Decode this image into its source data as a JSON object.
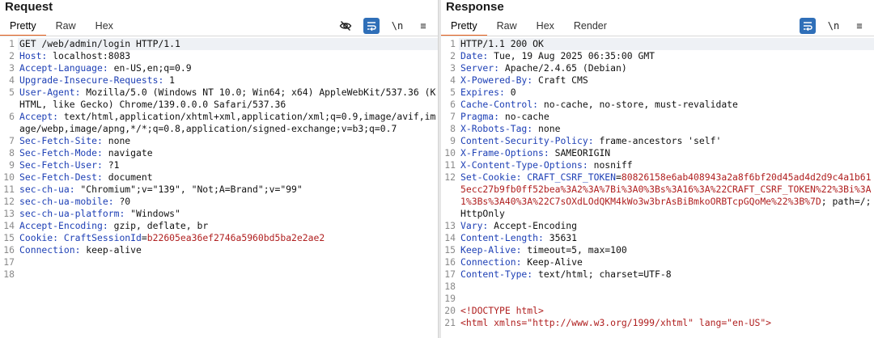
{
  "request": {
    "title": "Request",
    "tabs": [
      "Pretty",
      "Raw",
      "Hex"
    ],
    "active_tab": 0,
    "tools": {
      "wrap": "⇆",
      "newline": "\\n",
      "menu": "≡"
    },
    "lines": [
      {
        "n": "1",
        "text": "GET /web/admin/login HTTP/1.1"
      },
      {
        "n": "2",
        "name": "Host:",
        "value": " localhost:8083"
      },
      {
        "n": "3",
        "name": "Accept-Language:",
        "value": " en-US,en;q=0.9"
      },
      {
        "n": "4",
        "name": "Upgrade-Insecure-Requests:",
        "value": " 1"
      },
      {
        "n": "5",
        "name": "User-Agent:",
        "value": " Mozilla/5.0 (Windows NT 10.0; Win64; x64) AppleWebKit/537.36 (KHTML, like Gecko) Chrome/139.0.0.0 Safari/537.36"
      },
      {
        "n": "6",
        "name": "Accept:",
        "value": " text/html,application/xhtml+xml,application/xml;q=0.9,image/avif,image/webp,image/apng,*/*;q=0.8,application/signed-exchange;v=b3;q=0.7"
      },
      {
        "n": "7",
        "name": "Sec-Fetch-Site:",
        "value": " none"
      },
      {
        "n": "8",
        "name": "Sec-Fetch-Mode:",
        "value": " navigate"
      },
      {
        "n": "9",
        "name": "Sec-Fetch-User:",
        "value": " ?1"
      },
      {
        "n": "10",
        "name": "Sec-Fetch-Dest:",
        "value": " document"
      },
      {
        "n": "11",
        "name": "sec-ch-ua:",
        "value": " \"Chromium\";v=\"139\", \"Not;A=Brand\";v=\"99\""
      },
      {
        "n": "12",
        "name": "sec-ch-ua-mobile:",
        "value": " ?0"
      },
      {
        "n": "13",
        "name": "sec-ch-ua-platform:",
        "value": " \"Windows\""
      },
      {
        "n": "14",
        "name": "Accept-Encoding:",
        "value": " gzip, deflate, br"
      },
      {
        "n": "15",
        "name": "Cookie:",
        "cookie_name": " CraftSessionId",
        "cookie_eq": "=",
        "cookie_value": "b22605ea36ef2746a5960bd5ba2e2ae2"
      },
      {
        "n": "16",
        "name": "Connection:",
        "value": " keep-alive"
      },
      {
        "n": "17",
        "text": ""
      },
      {
        "n": "18",
        "text": ""
      }
    ]
  },
  "response": {
    "title": "Response",
    "tabs": [
      "Pretty",
      "Raw",
      "Hex",
      "Render"
    ],
    "active_tab": 0,
    "tools": {
      "wrap": "⇆",
      "newline": "\\n",
      "menu": "≡"
    },
    "lines": [
      {
        "n": "1",
        "text": "HTTP/1.1 200 OK"
      },
      {
        "n": "2",
        "name": "Date:",
        "value": " Tue, 19 Aug 2025 06:35:00 GMT"
      },
      {
        "n": "3",
        "name": "Server:",
        "value": " Apache/2.4.65 (Debian)"
      },
      {
        "n": "4",
        "name": "X-Powered-By:",
        "value": " Craft CMS"
      },
      {
        "n": "5",
        "name": "Expires:",
        "value": " 0"
      },
      {
        "n": "6",
        "name": "Cache-Control:",
        "value": " no-cache, no-store, must-revalidate"
      },
      {
        "n": "7",
        "name": "Pragma:",
        "value": " no-cache"
      },
      {
        "n": "8",
        "name": "X-Robots-Tag:",
        "value": " none"
      },
      {
        "n": "9",
        "name": "Content-Security-Policy:",
        "value": " frame-ancestors 'self'"
      },
      {
        "n": "10",
        "name": "X-Frame-Options:",
        "value": " SAMEORIGIN"
      },
      {
        "n": "11",
        "name": "X-Content-Type-Options:",
        "value": " nosniff"
      },
      {
        "n": "12",
        "name": "Set-Cookie:",
        "cookie_name": " CRAFT_CSRF_TOKEN",
        "cookie_eq": "=",
        "cookie_value": "80826158e6ab408943a2a8f6bf20d45ad4d2d9c4a1b615ecc27b9fb0ff52bea%3A2%3A%7Bi%3A0%3Bs%3A16%3A%22CRAFT_CSRF_TOKEN%22%3Bi%3A1%3Bs%3A40%3A%22C7sOXdLOdQKM4kWo3w3brAsBiBmkoORBTcpGQoMe%22%3B%7D",
        "cookie_tail": "; path=/; HttpOnly"
      },
      {
        "n": "13",
        "name": "Vary:",
        "value": " Accept-Encoding"
      },
      {
        "n": "14",
        "name": "Content-Length:",
        "value": " 35631"
      },
      {
        "n": "15",
        "name": "Keep-Alive:",
        "value": " timeout=5, max=100"
      },
      {
        "n": "16",
        "name": "Connection:",
        "value": " Keep-Alive"
      },
      {
        "n": "17",
        "name": "Content-Type:",
        "value": " text/html; charset=UTF-8"
      },
      {
        "n": "18",
        "text": ""
      },
      {
        "n": "19",
        "text": ""
      },
      {
        "n": "20",
        "xml": "<!DOCTYPE html>"
      },
      {
        "n": "21",
        "xml": "<html xmlns=\"http://www.w3.org/1999/xhtml\" lang=\"en-US\">"
      }
    ]
  }
}
